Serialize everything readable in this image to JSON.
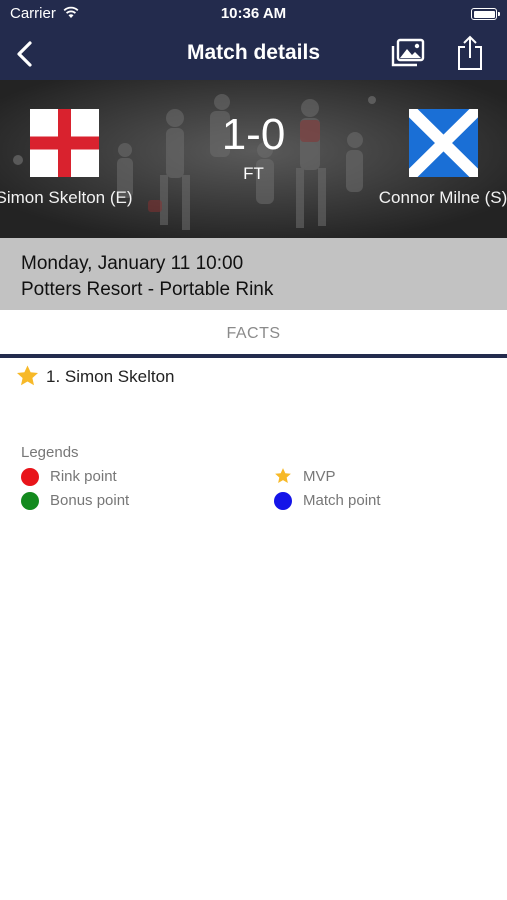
{
  "status_bar": {
    "carrier": "Carrier",
    "time": "10:36 AM"
  },
  "nav": {
    "title": "Match details",
    "icons": [
      "back-chevron-icon",
      "photo-gallery-icon",
      "share-icon"
    ]
  },
  "match": {
    "home_team": "Simon Skelton (E)",
    "away_team": "Connor Milne (S)",
    "home_flag": "england-flag-icon",
    "away_flag": "scotland-flag-icon",
    "score": "1-0",
    "status": "FT",
    "date_time": "Monday, January 11 10:00",
    "venue": "Potters Resort - Portable Rink"
  },
  "tabs": {
    "facts": "FACTS"
  },
  "facts": [
    {
      "icon": "mvp-star-icon",
      "text": "1. Simon Skelton"
    }
  ],
  "legends": {
    "title": "Legends",
    "items": [
      {
        "label": "Rink point",
        "color": "#e8141a",
        "icon": "dot"
      },
      {
        "label": "MVP",
        "color": "#f7b928",
        "icon": "star"
      },
      {
        "label": "Bonus point",
        "color": "#138a1e",
        "icon": "dot"
      },
      {
        "label": "Match point",
        "color": "#1414e8",
        "icon": "dot"
      }
    ]
  },
  "colors": {
    "navy": "#232b4d",
    "info_bar": "#c2c2c2",
    "star": "#f7b928"
  }
}
